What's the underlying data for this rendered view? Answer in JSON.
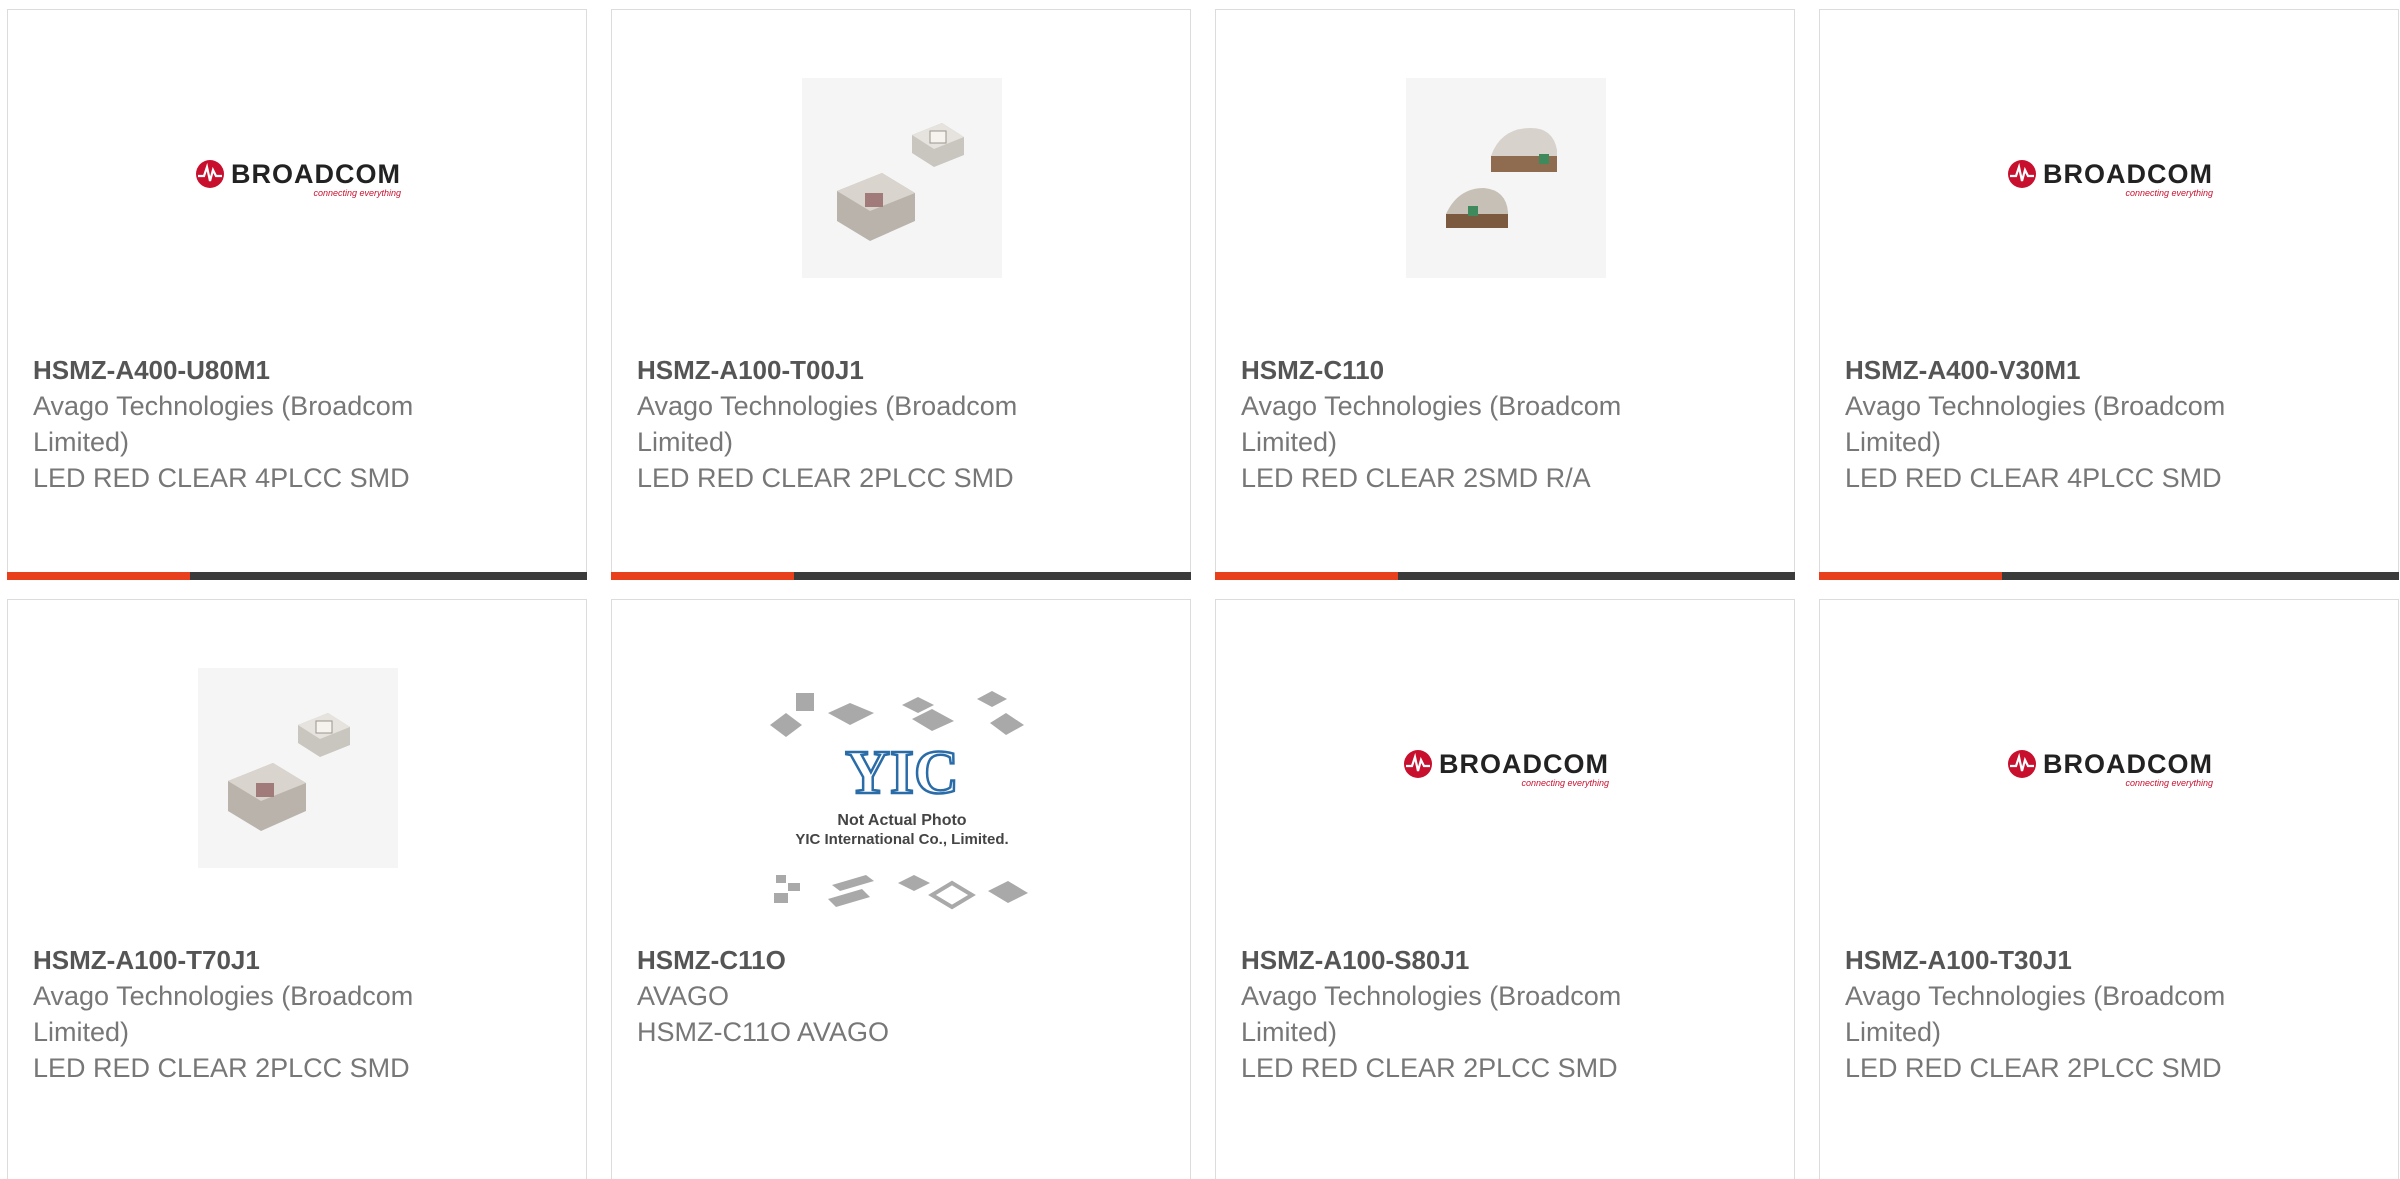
{
  "colors": {
    "accent": "#e8401c",
    "bar": "#3b3b3b",
    "text": "#777777",
    "title": "#555555"
  },
  "products": [
    {
      "part_number": "HSMZ-A400-U80M1",
      "manufacturer": "Avago Technologies (Broadcom Limited)",
      "description": "LED RED CLEAR 4PLCC SMD",
      "image": "broadcom-logo"
    },
    {
      "part_number": "HSMZ-A100-T00J1",
      "manufacturer": "Avago Technologies (Broadcom Limited)",
      "description": "LED RED CLEAR 2PLCC SMD",
      "image": "plcc-led-photo"
    },
    {
      "part_number": "HSMZ-C110",
      "manufacturer": "Avago Technologies (Broadcom Limited)",
      "description": "LED RED CLEAR 2SMD R/A",
      "image": "smd-ra-led-photo"
    },
    {
      "part_number": "HSMZ-A400-V30M1",
      "manufacturer": "Avago Technologies (Broadcom Limited)",
      "description": "LED RED CLEAR 4PLCC SMD",
      "image": "broadcom-logo"
    },
    {
      "part_number": "HSMZ-A100-T70J1",
      "manufacturer": "Avago Technologies (Broadcom Limited)",
      "description": "LED RED CLEAR 2PLCC SMD",
      "image": "plcc-led-photo"
    },
    {
      "part_number": "HSMZ-C11O",
      "manufacturer": "AVAGO",
      "description": "HSMZ-C11O AVAGO",
      "image": "yic-placeholder"
    },
    {
      "part_number": "HSMZ-A100-S80J1",
      "manufacturer": "Avago Technologies (Broadcom Limited)",
      "description": "LED RED CLEAR 2PLCC SMD",
      "image": "broadcom-logo"
    },
    {
      "part_number": "HSMZ-A100-T30J1",
      "manufacturer": "Avago Technologies (Broadcom Limited)",
      "description": "LED RED CLEAR 2PLCC SMD",
      "image": "broadcom-logo"
    }
  ],
  "logo": {
    "name": "BROADCOM",
    "tagline": "connecting everything"
  },
  "placeholder": {
    "brand": "YIC",
    "line1": "Not Actual Photo",
    "line2": "YIC International Co., Limited."
  }
}
